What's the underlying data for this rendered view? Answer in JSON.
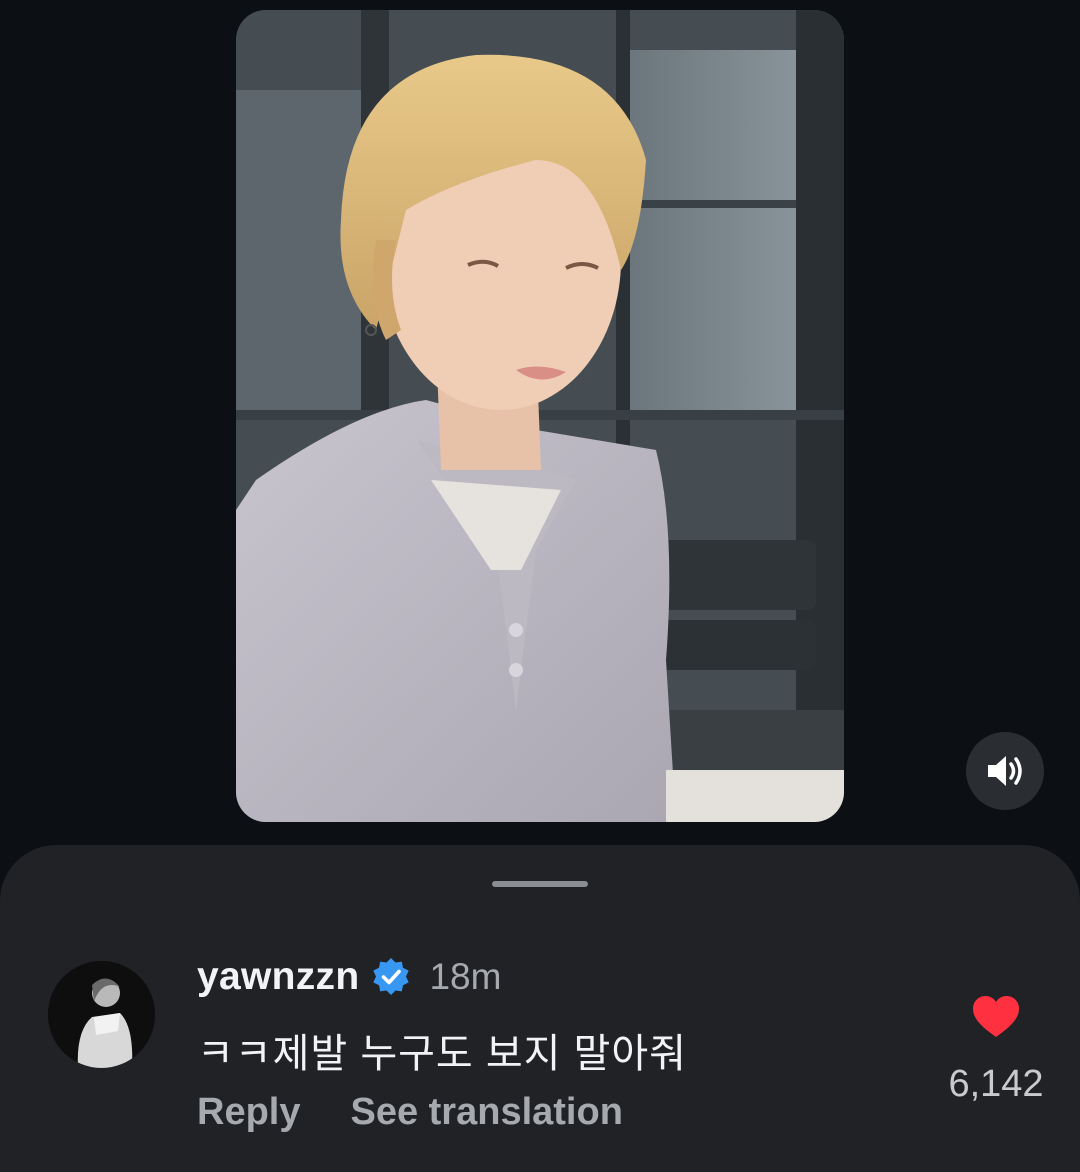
{
  "comment": {
    "username": "yawnzzn",
    "verified_icon": "verified-badge-icon",
    "timestamp": "18m",
    "text": "ㅋㅋ제발 누구도 보지 말아줘",
    "reply_label": "Reply",
    "translate_label": "See translation",
    "like_count": "6,142",
    "liked": true
  },
  "video": {
    "mute_icon": "speaker-on-icon"
  },
  "colors": {
    "sheet_bg": "#202226",
    "page_bg": "#0c0f14",
    "verified_blue": "#3897f0",
    "like_red": "#ff3040"
  }
}
